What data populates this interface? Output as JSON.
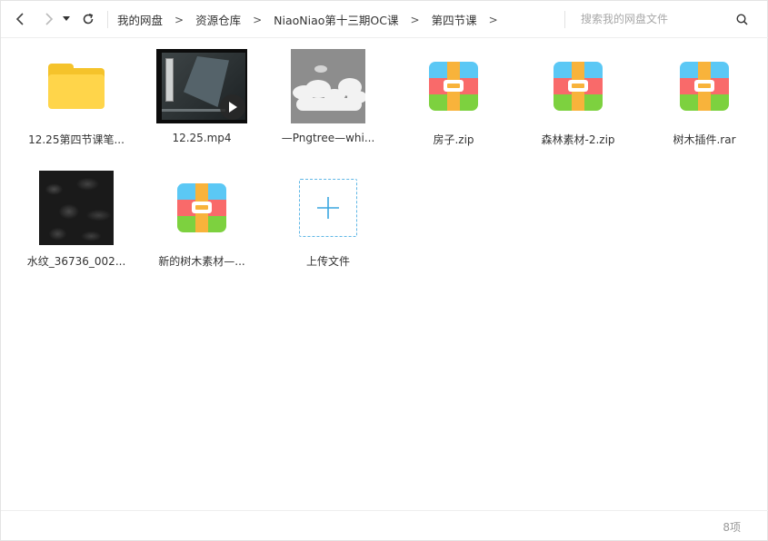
{
  "breadcrumb": [
    "我的网盘",
    "资源仓库",
    "NiaoNiao第十三期OC课",
    "第四节课"
  ],
  "breadcrumb_separator": ">",
  "search": {
    "placeholder": "搜索我的网盘文件"
  },
  "files": [
    {
      "name": "12.25第四节课笔...",
      "kind": "folder"
    },
    {
      "name": "12.25.mp4",
      "kind": "video"
    },
    {
      "name": "—Pngtree—whi...",
      "kind": "image-sky"
    },
    {
      "name": "房子.zip",
      "kind": "archive"
    },
    {
      "name": "森林素材-2.zip",
      "kind": "archive"
    },
    {
      "name": "树木插件.rar",
      "kind": "archive"
    },
    {
      "name": "水纹_36736_002...",
      "kind": "image-water"
    },
    {
      "name": "新的树木素材—...",
      "kind": "archive"
    }
  ],
  "upload": {
    "label": "上传文件"
  },
  "footer": {
    "count": "8项"
  },
  "colors": {
    "folder": "#ffd54a",
    "accent": "#5fb7e6",
    "archive_blue": "#5bc8f5",
    "archive_red": "#f96a6a",
    "archive_green": "#7dd13f",
    "archive_strap": "#f8b33b"
  }
}
